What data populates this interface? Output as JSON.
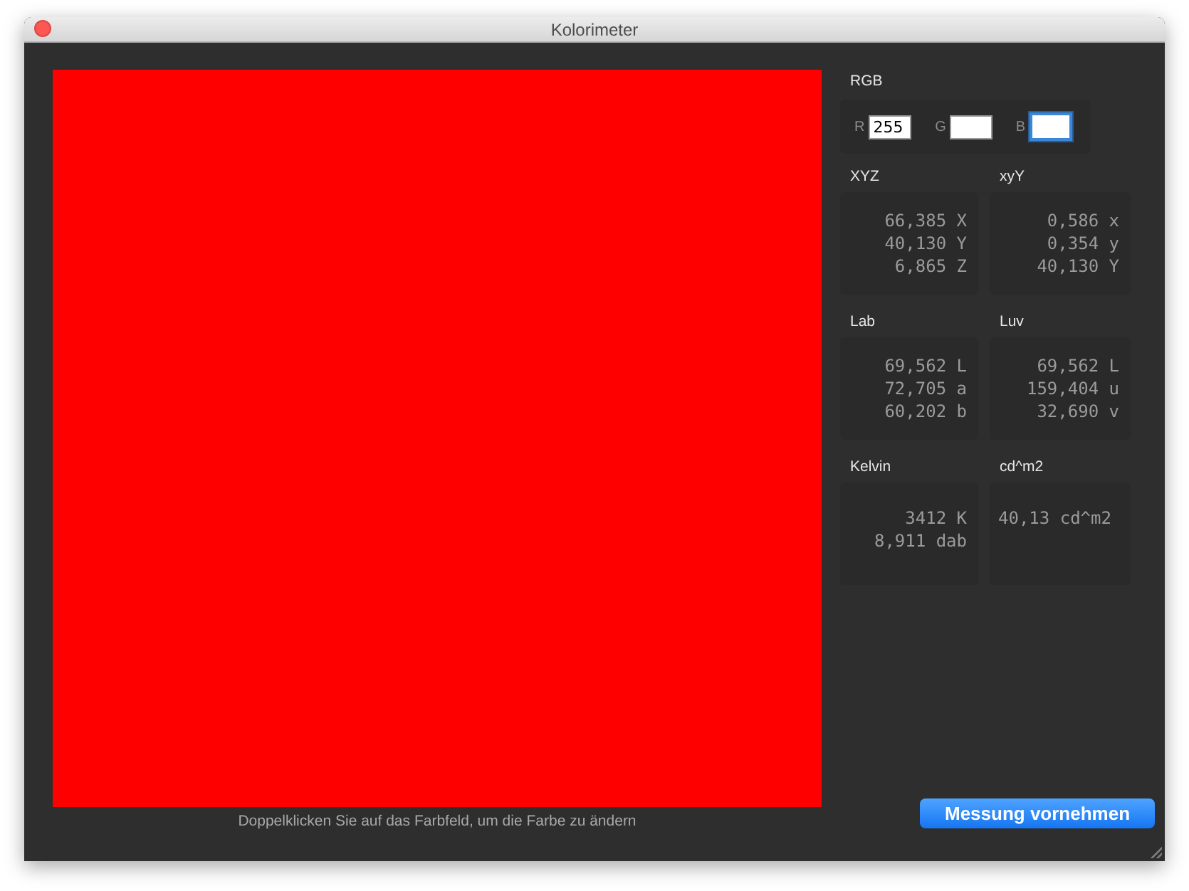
{
  "window": {
    "title": "Kolorimeter"
  },
  "swatch": {
    "color": "#ff0000",
    "hint": "Doppelklicken Sie auf das Farbfeld, um die Farbe zu ändern"
  },
  "rgb": {
    "title": "RGB",
    "fields": [
      {
        "label": "R",
        "value": "255",
        "focused": false
      },
      {
        "label": "G",
        "focused": false
      },
      {
        "label": "B",
        "focused": true
      }
    ]
  },
  "panels": [
    {
      "title": "XYZ",
      "kind": "table",
      "lines": [
        "66,385 X",
        "40,130 Y",
        "6,865 Z"
      ]
    },
    {
      "title": "xyY",
      "kind": "table",
      "lines": [
        "0,586 x",
        "0,354 y",
        "40,130 Y"
      ]
    },
    {
      "title": "Lab",
      "kind": "table",
      "lines": [
        "69,562 L",
        "72,705 a",
        "60,202 b"
      ]
    },
    {
      "title": "Luv",
      "kind": "table",
      "lines": [
        "69,562 L",
        "159,404 u",
        "32,690 v"
      ]
    },
    {
      "title": "Kelvin",
      "kind": "table",
      "lines": [
        "3412 K",
        "8,911 dab"
      ]
    },
    {
      "title": "cd^m2",
      "kind": "reading",
      "lines": [
        "40,13 cd^m2"
      ]
    }
  ],
  "button": "Messung vornehmen"
}
